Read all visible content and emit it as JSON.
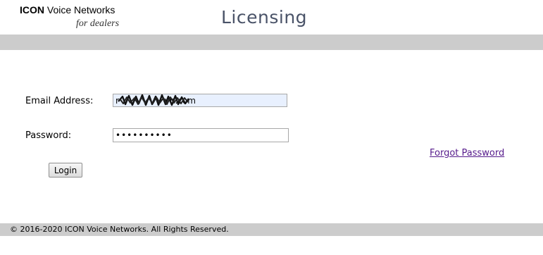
{
  "header": {
    "logo_brand": "ICON",
    "logo_rest": " Voice Networks",
    "logo_tagline": "for dealers",
    "title": "Licensing"
  },
  "form": {
    "email_label": "Email Address:",
    "email_value": "r                 vn.com",
    "password_label": "Password:",
    "password_value": "••••••••••",
    "forgot_link": "Forgot Password",
    "login_button": "Login"
  },
  "footer": {
    "copyright": "© 2016-2020 ICON Voice Networks. All Rights Reserved."
  },
  "colors": {
    "bar_gray": "#cccccc",
    "title_color": "#4a5368",
    "link_visited": "#551a8b",
    "autofill_bg": "#e8f0fe"
  }
}
